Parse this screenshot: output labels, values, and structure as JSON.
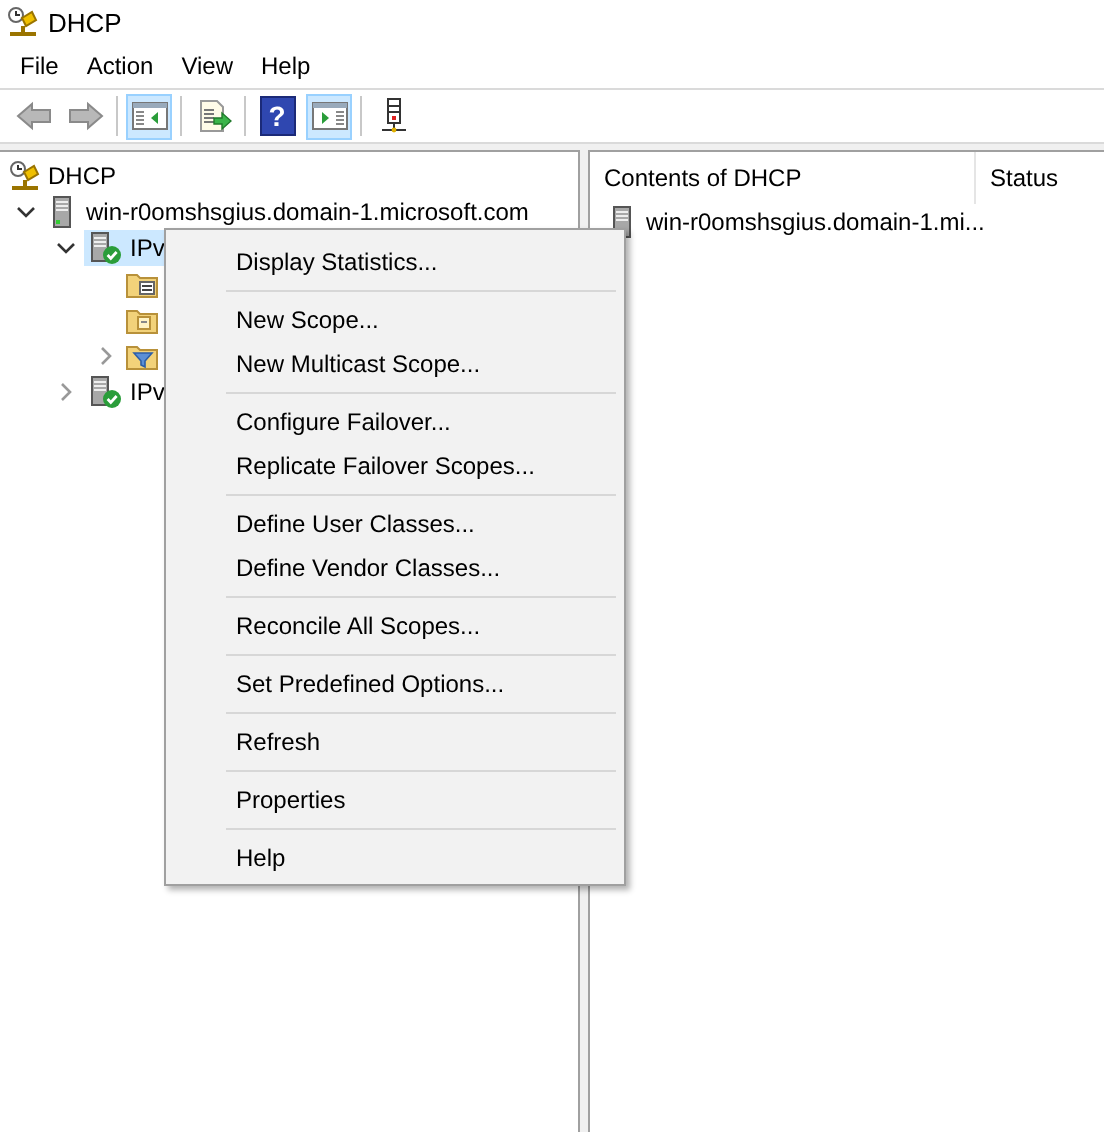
{
  "window": {
    "title": "DHCP"
  },
  "menu_bar": [
    "File",
    "Action",
    "View",
    "Help"
  ],
  "toolbar": [
    {
      "buttons": [
        {
          "kind": "back",
          "disabled": true,
          "pressed": false
        },
        {
          "kind": "forward",
          "disabled": true,
          "pressed": false
        }
      ]
    },
    {
      "buttons": [
        {
          "kind": "tree",
          "disabled": false,
          "pressed": true
        }
      ]
    },
    {
      "buttons": [
        {
          "kind": "export",
          "disabled": false,
          "pressed": false
        }
      ]
    },
    {
      "buttons": [
        {
          "kind": "help",
          "glyph": "?",
          "disabled": false,
          "pressed": false
        },
        {
          "kind": "pane",
          "disabled": false,
          "pressed": true
        }
      ]
    },
    {
      "buttons": [
        {
          "kind": "server",
          "disabled": false,
          "pressed": false
        }
      ]
    }
  ],
  "tree": [
    {
      "kind": "root",
      "label": "DHCP",
      "selected": false,
      "children": [
        {
          "kind": "server",
          "label": "win-r0omshsgius.domain-1.microsoft.com",
          "expandable": true,
          "expanded": true,
          "selected": false,
          "children": [
            {
              "kind": "protocol",
              "label": "IPv",
              "expandable": true,
              "expanded": true,
              "selected": true,
              "children": [
                {
                  "kind": "folder",
                  "expandable": false,
                  "selected": false
                },
                {
                  "kind": "folder",
                  "expandable": false,
                  "selected": false
                },
                {
                  "kind": "filter",
                  "expandable": true,
                  "expanded": false,
                  "selected": false
                }
              ]
            },
            {
              "kind": "protocol",
              "label": "IPv",
              "expandable": true,
              "expanded": false,
              "selected": false
            }
          ]
        }
      ]
    }
  ],
  "list": {
    "columns": [
      "Contents of DHCP",
      "Status"
    ],
    "rows": [
      {
        "name": "win-r0omshsgius.domain-1.mi..."
      }
    ]
  },
  "context_menu": {
    "groups": [
      [
        "Display Statistics..."
      ],
      [
        "New Scope...",
        "New Multicast Scope..."
      ],
      [
        "Configure Failover...",
        "Replicate Failover Scopes..."
      ],
      [
        "Define User Classes...",
        "Define Vendor Classes..."
      ],
      [
        "Reconcile All Scopes..."
      ],
      [
        "Set Predefined Options..."
      ],
      [
        "Refresh"
      ],
      [
        "Properties"
      ],
      [
        "Help"
      ]
    ]
  }
}
